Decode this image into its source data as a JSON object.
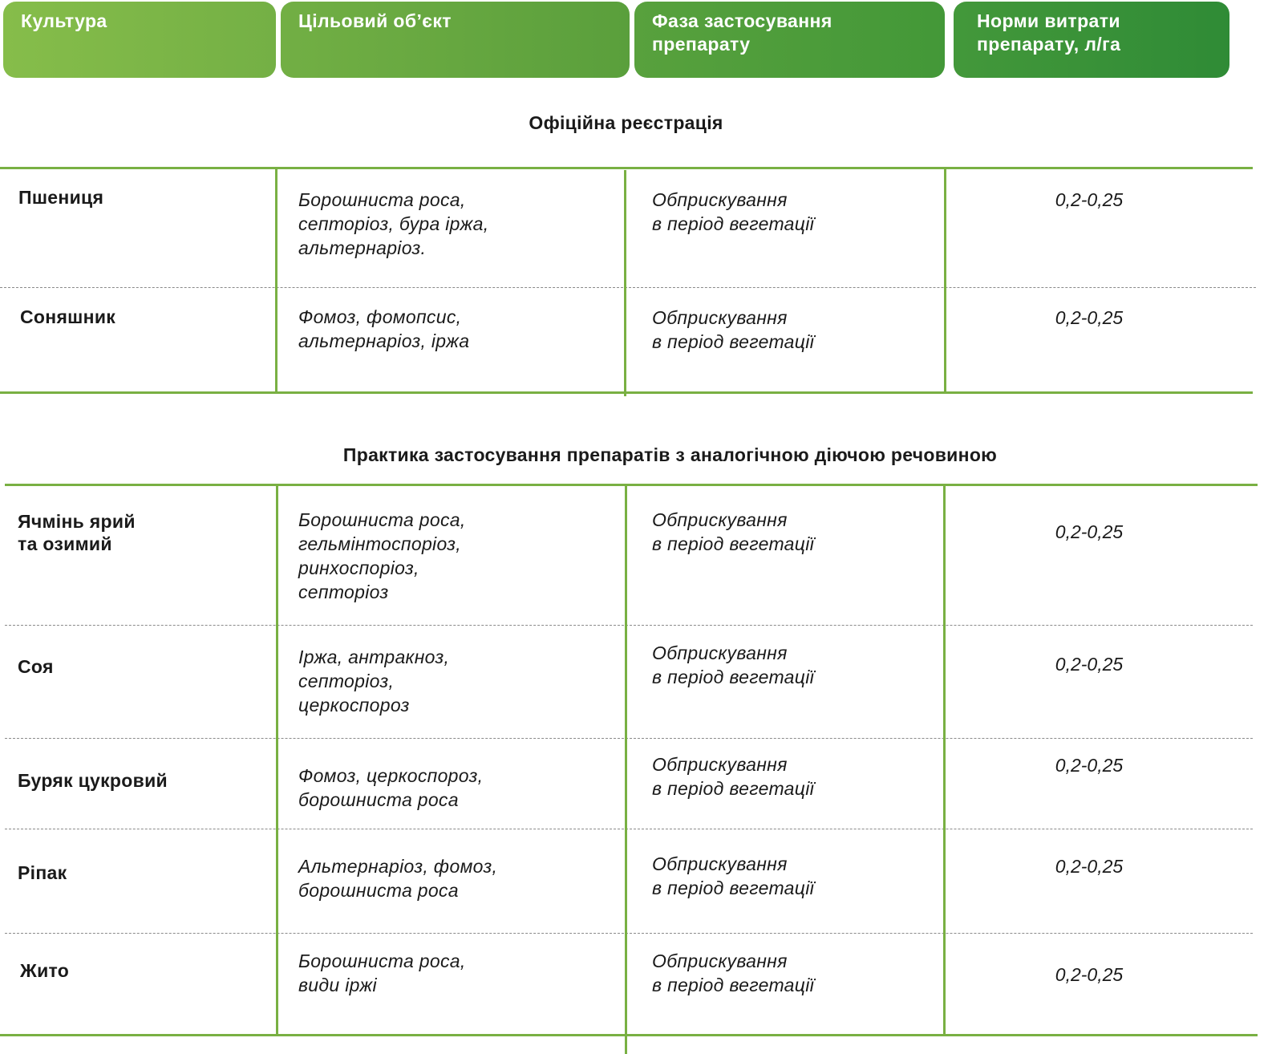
{
  "headers": {
    "crop": "Культура",
    "target_line1": "Цільовий об’єкт",
    "phase_line1": "Фаза застосування",
    "phase_line2": "препарату",
    "rate_line1": "Норми витрати",
    "rate_line2": "препарату, л/га"
  },
  "sections": {
    "official": "Офіційна реєстрація",
    "practice": "Практика застосування препаратів з аналогічною діючою речовиною"
  },
  "official_rows": [
    {
      "crop": [
        "Пшениця"
      ],
      "target": [
        "Борошниста роса,",
        "септоріоз, бура іржа,",
        "альтернаріоз."
      ],
      "phase": [
        "Обприскування",
        "в період вегетації"
      ],
      "rate": "0,2-0,25"
    },
    {
      "crop": [
        "Соняшник"
      ],
      "target": [
        "Фомоз, фомопсис,",
        "альтернаріоз, іржа"
      ],
      "phase": [
        "Обприскування",
        "в період вегетації"
      ],
      "rate": "0,2-0,25"
    }
  ],
  "practice_rows": [
    {
      "crop": [
        "Ячмінь ярий",
        "та озимий"
      ],
      "target": [
        "Борошниста роса,",
        "гельмінтоспоріоз,",
        "ринхоспоріоз,",
        "септоріоз"
      ],
      "phase": [
        "Обприскування",
        "в період вегетації"
      ],
      "rate": "0,2-0,25"
    },
    {
      "crop": [
        "Соя"
      ],
      "target": [
        "Іржа, антракноз,",
        "септоріоз,",
        "церкоспороз"
      ],
      "phase": [
        "Обприскування",
        "в період вегетації"
      ],
      "rate": "0,2-0,25"
    },
    {
      "crop": [
        "Буряк цукровий"
      ],
      "target": [
        "Фомоз, церкоспороз,",
        "борошниста роса"
      ],
      "phase": [
        "Обприскування",
        "в період вегетації"
      ],
      "rate": "0,2-0,25"
    },
    {
      "crop": [
        "Ріпак"
      ],
      "target": [
        "Альтернаріоз, фомоз,",
        "борошниста роса"
      ],
      "phase": [
        "Обприскування",
        "в період вегетації"
      ],
      "rate": "0,2-0,25"
    },
    {
      "crop": [
        "Жито"
      ],
      "target": [
        "Борошниста роса,",
        "види іржі"
      ],
      "phase": [
        "Обприскування",
        "в період вегетації"
      ],
      "rate": "0,2-0,25"
    }
  ],
  "colors": {
    "rule_green": "#79b043",
    "header_start": "#86bd4a",
    "header_end": "#2f8b36"
  }
}
